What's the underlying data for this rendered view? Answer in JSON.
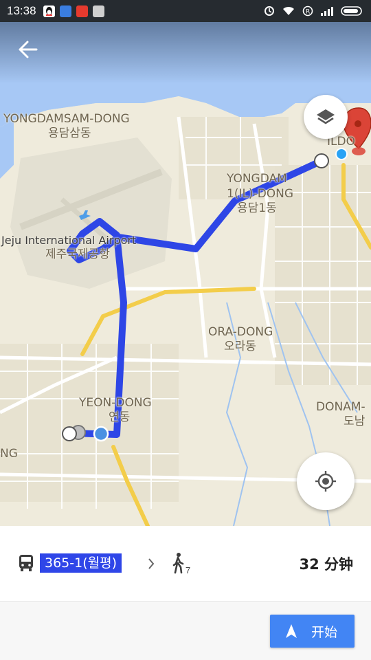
{
  "status_bar": {
    "time": "13:38"
  },
  "map": {
    "labels": {
      "yongdamsam_en": "YONGDAMSAM-DONG",
      "yongdamsam_ko": "용담삼동",
      "yongdam1_en": "YONGDAM",
      "yongdam1_en2": "1(IL)-DONG",
      "yongdam1_ko": "용담1동",
      "ildo_en": "ILDO",
      "airport_en": "Jeju International Airport",
      "airport_ko": "제주국제공항",
      "ora_en": "ORA-DONG",
      "ora_ko": "오라동",
      "yeon_en": "YEON-DONG",
      "yeon_ko": "연동",
      "donam_en": "DONAM-",
      "donam_ko": "도남",
      "ng": "NG"
    },
    "route_color": "#2e46e6",
    "destination_marker_color": "#db4437"
  },
  "route": {
    "bus_number": "365-1(월평)",
    "walk_minutes": "7",
    "duration": "32 分钟"
  },
  "actions": {
    "start_label": "开始"
  },
  "icons": {
    "back": "arrow-left-icon",
    "layers": "layers-icon",
    "location": "my-location-icon",
    "bus": "bus-icon",
    "walk": "walk-icon",
    "navigate": "navigation-arrow-icon",
    "chevron": "chevron-right-icon"
  }
}
